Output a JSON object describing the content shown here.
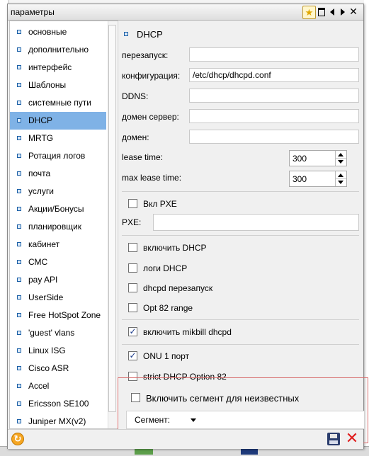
{
  "window": {
    "title": "параметры"
  },
  "sidebar": {
    "items": [
      {
        "label": "основные",
        "active": false
      },
      {
        "label": "дополнительно",
        "active": false
      },
      {
        "label": "интерфейс",
        "active": false
      },
      {
        "label": "Шаблоны",
        "active": false
      },
      {
        "label": "системные пути",
        "active": false
      },
      {
        "label": "DHCP",
        "active": true
      },
      {
        "label": "MRTG",
        "active": false
      },
      {
        "label": "Ротация логов",
        "active": false
      },
      {
        "label": "почта",
        "active": false
      },
      {
        "label": "услуги",
        "active": false
      },
      {
        "label": "Акции/Бонусы",
        "active": false
      },
      {
        "label": "планировщик",
        "active": false
      },
      {
        "label": "кабинет",
        "active": false
      },
      {
        "label": "СМС",
        "active": false
      },
      {
        "label": "pay API",
        "active": false
      },
      {
        "label": "UserSide",
        "active": false
      },
      {
        "label": "Free HotSpot Zone",
        "active": false
      },
      {
        "label": "'guest' vlans",
        "active": false
      },
      {
        "label": "Linux ISG",
        "active": false
      },
      {
        "label": "Cisco ASR",
        "active": false
      },
      {
        "label": "Accel",
        "active": false
      },
      {
        "label": "Ericsson SE100",
        "active": false
      },
      {
        "label": "Juniper MX(v2)",
        "active": false
      }
    ]
  },
  "main": {
    "section_title": "DHCP",
    "fields": {
      "restart_label": "перезапуск:",
      "restart_value": "",
      "config_label": "конфигурация:",
      "config_value": "/etc/dhcp/dhcpd.conf",
      "ddns_label": "DDNS:",
      "ddns_value": "",
      "domain_server_label": "домен сервер:",
      "domain_server_value": "",
      "domain_label": "домен:",
      "domain_value": "",
      "lease_time_label": "lease time:",
      "lease_time_value": "300",
      "max_lease_time_label": "max lease time:",
      "max_lease_time_value": "300"
    },
    "pxe": {
      "enable_label": "Вкл PXE",
      "enable_checked": false,
      "pxe_label": "PXE:",
      "pxe_value": ""
    },
    "checkboxes": {
      "enable_dhcp": {
        "label": "включить DHCP",
        "checked": false
      },
      "dhcp_logs": {
        "label": "логи DHCP",
        "checked": false
      },
      "dhcpd_restart": {
        "label": "dhcpd перезапуск",
        "checked": false
      },
      "opt82_range": {
        "label": "Opt 82 range",
        "checked": false
      },
      "enable_mikbill_dhcpd": {
        "label": "включить mikbill dhcpd",
        "checked": true
      },
      "onu_one_port": {
        "label": "ONU 1 порт",
        "checked": true
      },
      "strict_opt82": {
        "label": "strict DHCP Option 82",
        "checked": false
      },
      "unknown_segment": {
        "label": "Включить сегмент для неизвестных",
        "checked": false
      }
    },
    "segment": {
      "label": "Сегмент:",
      "value": ""
    }
  },
  "colors": {
    "active_item": "#7fb2e6",
    "highlight_border": "#d76b6b",
    "cancel": "#e02020",
    "refresh": "#f5a623"
  }
}
